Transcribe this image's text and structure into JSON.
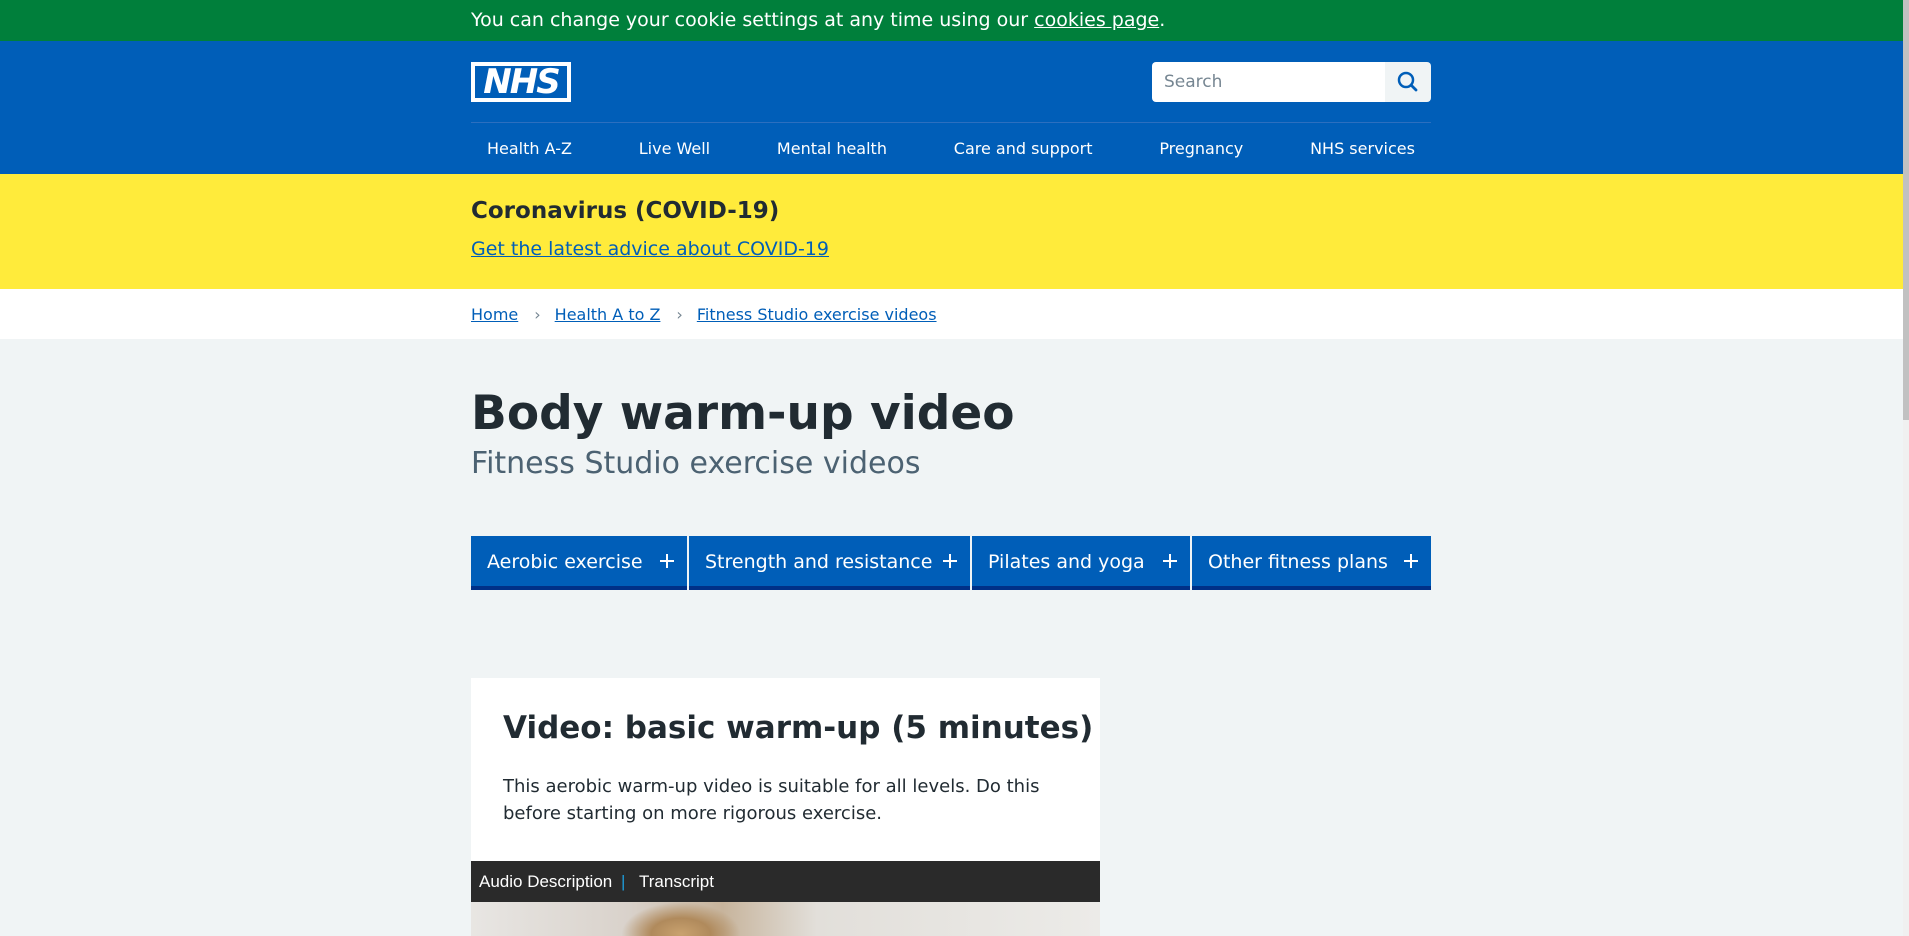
{
  "cookie_banner": {
    "text": "You can change your cookie settings at any time using our ",
    "link": "cookies page",
    "suffix": "."
  },
  "header": {
    "logo_text": "NHS",
    "search": {
      "placeholder": "Search"
    },
    "nav": [
      "Health A-Z",
      "Live Well",
      "Mental health",
      "Care and support",
      "Pregnancy",
      "NHS services"
    ]
  },
  "covid_banner": {
    "title": "Coronavirus (COVID-19)",
    "link": "Get the latest advice about COVID-19"
  },
  "breadcrumb": [
    "Home",
    "Health A to Z",
    "Fitness Studio exercise videos"
  ],
  "page": {
    "title": "Body warm-up video",
    "subtitle": "Fitness Studio exercise videos"
  },
  "categories": [
    "Aerobic exercise",
    "Strength and resistance",
    "Pilates and yoga",
    "Other fitness plans"
  ],
  "video_card": {
    "heading": "Video: basic warm-up (5 minutes)",
    "description": "This aerobic warm-up video is suitable for all levels. Do this before starting on more rigorous exercise.",
    "player": {
      "audio_description": "Audio Description",
      "separator": "|",
      "transcript": "Transcript"
    }
  },
  "colors": {
    "cookie_green": "#007f3b",
    "nhs_blue": "#005eb8",
    "covid_yellow": "#ffeb3b",
    "page_bg": "#f0f4f5",
    "button_shadow": "#003087"
  }
}
